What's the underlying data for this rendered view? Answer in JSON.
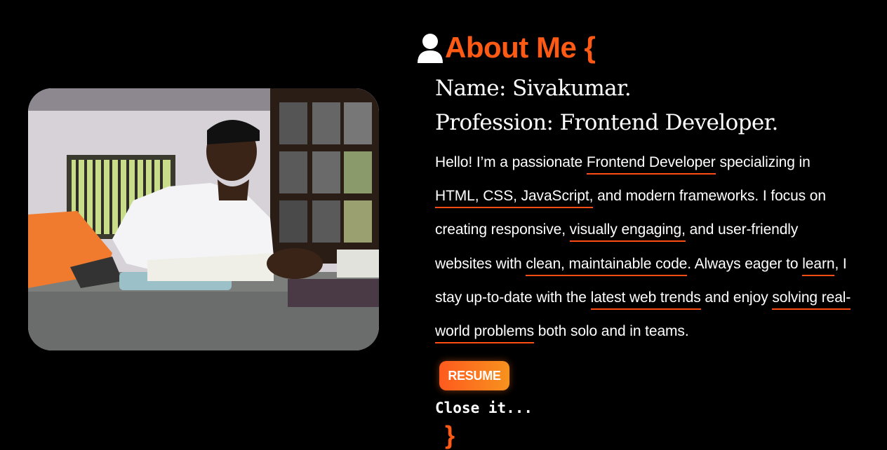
{
  "about": {
    "heading": "About Me {",
    "name_line": "Name: Sivakumar.",
    "profession_line": "Profession: Frontend Developer.",
    "bio": {
      "p1": "Hello! I’m a passionate ",
      "h1": "Frontend Developer",
      "p2": " specializing in ",
      "h2": "HTML, CSS, JavaScript,",
      "p3": " and modern frameworks. I focus on creating responsive, ",
      "h3": "visually engaging,",
      "p4": " and user-friendly websites with ",
      "h4": "clean, maintainable code",
      "p5": ". Always eager to ",
      "h5": "learn",
      "p6": ", I stay up-to-date with the ",
      "h6": "latest web trends",
      "p7": " and enjoy ",
      "h7": "solving real-world problems",
      "p8": " both solo and in teams."
    },
    "resume_label": "RESUME",
    "close_text": "Close it...",
    "closing_brace": "}"
  },
  "icons": {
    "heading_icon": "user-icon"
  },
  "colors": {
    "accent": "#ff5a14",
    "underline": "#ff4d14",
    "button_gradient_start": "#ff5a1e",
    "button_gradient_end": "#f7921e",
    "background": "#000000"
  }
}
